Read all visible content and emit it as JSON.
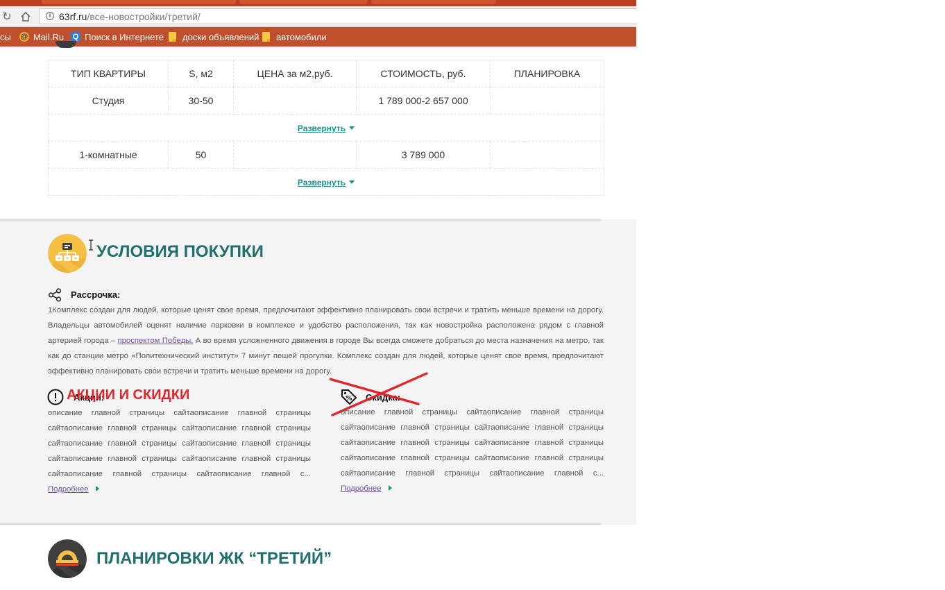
{
  "browser": {
    "url_host": "63rf.ru",
    "url_path": "/все-новостройки/третий/",
    "bookmarks": [
      {
        "label": "сы",
        "icon": ""
      },
      {
        "label": "Mail.Ru",
        "icon": "mailru-icon"
      },
      {
        "label": "Поиск в Интернете",
        "icon": "search-icon"
      },
      {
        "label": "доски объявлений",
        "icon": "folder-icon"
      },
      {
        "label": "автомобили",
        "icon": "folder-icon"
      }
    ]
  },
  "price_table": {
    "headers": [
      "ТИП КВАРТИРЫ",
      "S, м2",
      "ЦЕНА за м2,руб.",
      "СТОИМОСТЬ, руб.",
      "ПЛАНИРОВКА"
    ],
    "rows": [
      {
        "type": "Студия",
        "area": "30-50",
        "price_m2": "",
        "cost": "1 789 000-2 657 000",
        "plan": ""
      },
      {
        "type": "1-комнатные",
        "area": "50",
        "price_m2": "",
        "cost": "3 789 000",
        "plan": ""
      }
    ],
    "expand_label": "Развернуть"
  },
  "purchase": {
    "title": "УСЛОВИЯ ПОКУПКИ",
    "installment_title": "Рассрочка:",
    "installment_text_before": "1Комплекс создан для людей, которые ценят свое время, предпочитают эффективно планировать свои встречи и тратить меньше времени на дорогу. Владельцы автомобилей оценят наличие парковки в комплексе и удобство расположения, так как новостройка расположена рядом с главной артерией города – ",
    "installment_link": "проспектом Победы.",
    "installment_text_after": " А во время усложненного движения в городе Вы всегда сможете добраться до места назначения на метро, так как до станции метро «Политехнический институт» 7 минут пешей прогулки. Комплекс создан для людей, которые ценят свое время, предпочитают эффективно планировать свои встречи и тратить меньше времени на дорогу.",
    "promo_title": "Акции:",
    "promo_overlay": "АКЦИИ И СКИДКИ",
    "promo_text": "описание главной страницы сайтаописание главной страницы сайтаописание главной страницы сайтаописание главной страницы сайтаописание главной страницы сайтаописание главной страницы сайтаописание главной страницы сайтаописание главной страницы сайтаописание главной страницы сайтаописание главной с...",
    "discount_title": "Скидка:",
    "discount_text": "описание главной страницы сайтаописание главной страницы сайтаописание главной страницы сайтаописание главной страницы сайтаописание главной страницы сайтаописание главной страницы сайтаописание главной страницы сайтаописание главной страницы сайтаописание главной страницы сайтаописание главной с...",
    "more_label": "Подробнее"
  },
  "layouts": {
    "title": "ПЛАНИРОВКИ ЖК “ТРЕТИЙ”"
  },
  "colors": {
    "accent_teal": "#1f6f6f",
    "link_teal": "#1d8f8f",
    "overlay_red": "#e2242b",
    "icon_yellow": "#f6c044",
    "icon_dark": "#3f3f3f",
    "chrome_orange": "#c0502b"
  }
}
